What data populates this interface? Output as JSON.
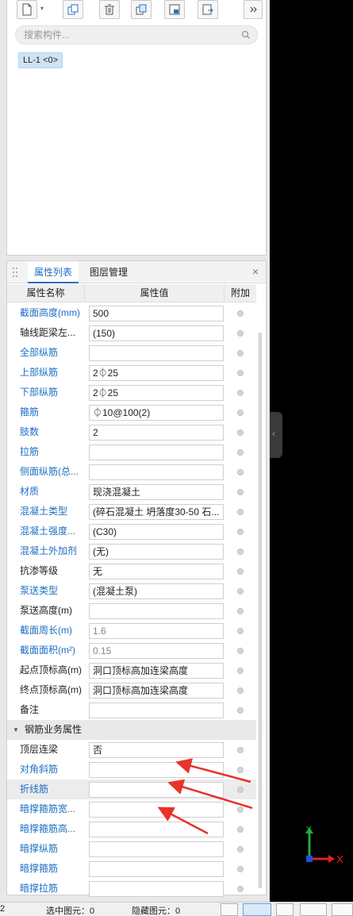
{
  "toolbar": {
    "icons": [
      "new-icon",
      "copy-icon",
      "delete-icon",
      "layer-copy-icon",
      "floor-copy-icon",
      "export-icon",
      "more-icon"
    ]
  },
  "search": {
    "placeholder": "搜索构件..."
  },
  "component_list": [
    {
      "label": "LL-1 <0>"
    }
  ],
  "prop_panel": {
    "tabs": [
      {
        "label": "属性列表",
        "active": true
      },
      {
        "label": "图层管理",
        "active": false
      }
    ],
    "close": "×",
    "columns": {
      "name": "属性名称",
      "value": "属性值",
      "extra": "附加"
    },
    "rows": [
      {
        "name": "截面高度(mm)",
        "value": "500",
        "blue": true
      },
      {
        "name": "轴线距梁左...",
        "value": "(150)",
        "blue": false
      },
      {
        "name": "全部纵筋",
        "value": "",
        "blue": true
      },
      {
        "name": "上部纵筋",
        "value": "2⏀25",
        "blue": true
      },
      {
        "name": "下部纵筋",
        "value": "2⏀25",
        "blue": true
      },
      {
        "name": "箍筋",
        "value": "⏀10@100(2)",
        "blue": true
      },
      {
        "name": "肢数",
        "value": "2",
        "blue": true
      },
      {
        "name": "拉筋",
        "value": "",
        "blue": true
      },
      {
        "name": "侧面纵筋(总...",
        "value": "",
        "blue": true
      },
      {
        "name": "材质",
        "value": "现浇混凝土",
        "blue": true
      },
      {
        "name": "混凝土类型",
        "value": "(碎石混凝土 坍落度30-50 石...",
        "blue": true
      },
      {
        "name": "混凝土强度...",
        "value": "(C30)",
        "blue": true
      },
      {
        "name": "混凝土外加剂",
        "value": "(无)",
        "blue": true
      },
      {
        "name": "抗渗等级",
        "value": "无",
        "blue": false
      },
      {
        "name": "泵送类型",
        "value": "(混凝土泵)",
        "blue": true
      },
      {
        "name": "泵送高度(m)",
        "value": "",
        "blue": false
      },
      {
        "name": "截面周长(m)",
        "value": "1.6",
        "blue": true,
        "gray": true
      },
      {
        "name": "截面面积(m²)",
        "value": "0.15",
        "blue": true,
        "gray": true
      },
      {
        "name": "起点顶标高(m)",
        "value": "洞口顶标高加连梁高度",
        "blue": false
      },
      {
        "name": "终点顶标高(m)",
        "value": "洞口顶标高加连梁高度",
        "blue": false
      },
      {
        "name": "备注",
        "value": "",
        "blue": false
      }
    ],
    "group": {
      "label": "钢筋业务属性"
    },
    "group_rows": [
      {
        "name": "顶层连梁",
        "value": "否",
        "blue": false
      },
      {
        "name": "对角斜筋",
        "value": "",
        "blue": true
      },
      {
        "name": "折线筋",
        "value": "",
        "blue": true,
        "highlight": true
      },
      {
        "name": "暗撑箍筋宽...",
        "value": "",
        "blue": true
      },
      {
        "name": "暗撑箍筋高...",
        "value": "",
        "blue": true
      },
      {
        "name": "暗撑纵筋",
        "value": "",
        "blue": true
      },
      {
        "name": "暗撑箍筋",
        "value": "",
        "blue": true
      },
      {
        "name": "暗撑拉筋",
        "value": "",
        "blue": true
      }
    ]
  },
  "axes": {
    "x": "X",
    "y": "Y"
  },
  "status": {
    "left_num": "2",
    "selected": "选中图元：0",
    "hidden": "隐藏图元：0"
  },
  "colors": {
    "accent": "#1c6fc2",
    "arrow": "#e8322a",
    "axis_x": "#e02020",
    "axis_y": "#1fae33",
    "axis_z": "#1e4fe0"
  }
}
